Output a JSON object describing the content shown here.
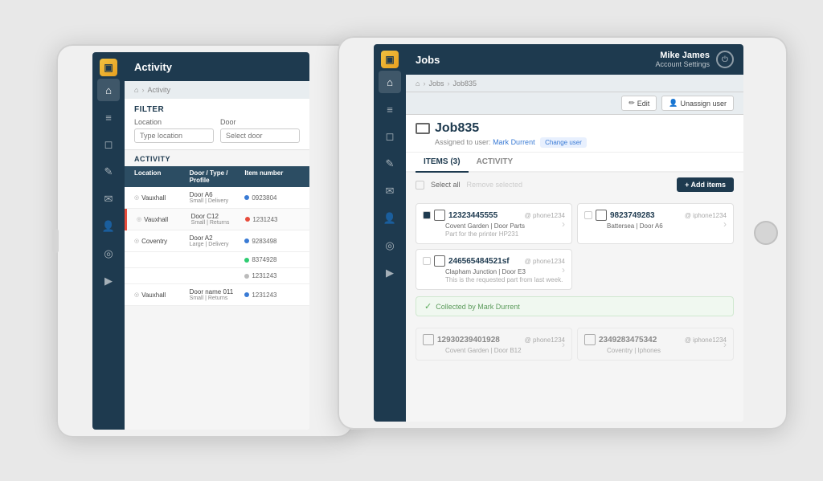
{
  "background_color": "#e0e0e0",
  "left_tablet": {
    "title": "Activity",
    "breadcrumb": [
      "🏠",
      "Activity"
    ],
    "filter": {
      "label": "FILTER",
      "location_label": "Location",
      "location_placeholder": "Type location",
      "door_label": "Door",
      "door_placeholder": "Select door"
    },
    "activity_label": "ACTIVITY",
    "table_headers": [
      "Location",
      "Door / Type / Profile",
      "Item number"
    ],
    "rows": [
      {
        "location": "Vauxhall",
        "door": "Door A6",
        "type": "Small | Delivery",
        "dot": "blue",
        "number": "0923804"
      },
      {
        "location": "Vauxhall",
        "door": "Door C12",
        "type": "Small | Returns",
        "dot": "red",
        "number": "1231243",
        "alert": true
      },
      {
        "location": "Coventry",
        "door": "Door A2",
        "type": "Large | Delivery",
        "dot": "blue",
        "number": "9283498"
      },
      {
        "location": "",
        "door": "",
        "type": "",
        "dot": "green",
        "number": "8374928"
      },
      {
        "location": "",
        "door": "",
        "type": "",
        "dot": "gray",
        "number": "1231243"
      },
      {
        "location": "Vauxhall",
        "door": "Door name 011",
        "type": "Small | Returns",
        "dot": "blue",
        "number": "1231243"
      }
    ]
  },
  "right_tablet": {
    "title": "Jobs",
    "user": {
      "name": "Mike James",
      "subtitle": "Account Settings"
    },
    "breadcrumb": [
      "🏠",
      "Jobs",
      "Job835"
    ],
    "action_bar": {
      "edit_label": "Edit",
      "unassign_label": "Unassign user"
    },
    "job": {
      "name": "Job835",
      "assigned_text": "Assigned to user:",
      "assigned_user": "Mark Durrent",
      "change_user_label": "Change user"
    },
    "tabs": [
      "ITEMS (3)",
      "ACTIVITY"
    ],
    "active_tab": "ITEMS (3)",
    "toolbar": {
      "select_all": "Select all",
      "remove_selected": "Remove selected",
      "add_items": "+ Add items"
    },
    "items": [
      {
        "number": "12323445555",
        "profile": "@ phone1234",
        "location": "Covent Garden | Door Parts",
        "desc": "Part for the printer HP231",
        "checked": true,
        "gray": false
      },
      {
        "number": "9823749283",
        "profile": "@ iphone1234",
        "location": "Battersea | Door A6",
        "desc": "",
        "checked": false,
        "gray": false
      },
      {
        "number": "246565484521sf",
        "profile": "@ phone1234",
        "location": "Clapham Junction | Door E3",
        "desc": "This is the requested part from last week.",
        "checked": false,
        "gray": false
      }
    ],
    "collected_banner": "Collected by Mark Durrent",
    "bottom_items": [
      {
        "number": "12930239401928",
        "profile": "@ phone1234",
        "location": "Covent Garden | Door B12",
        "gray": true
      },
      {
        "number": "2349283475342",
        "profile": "@ iphone1234",
        "location": "Coventry | Iphones",
        "gray": true
      }
    ]
  },
  "icons": {
    "home": "⌂",
    "activity": "≡",
    "package": "📦",
    "brush": "✏",
    "mail": "✉",
    "user": "👤",
    "location": "◎",
    "truck": "🚚",
    "power": "⏻",
    "edit": "✏",
    "check": "✓",
    "arrow_right": "›",
    "shield": "🔒"
  }
}
